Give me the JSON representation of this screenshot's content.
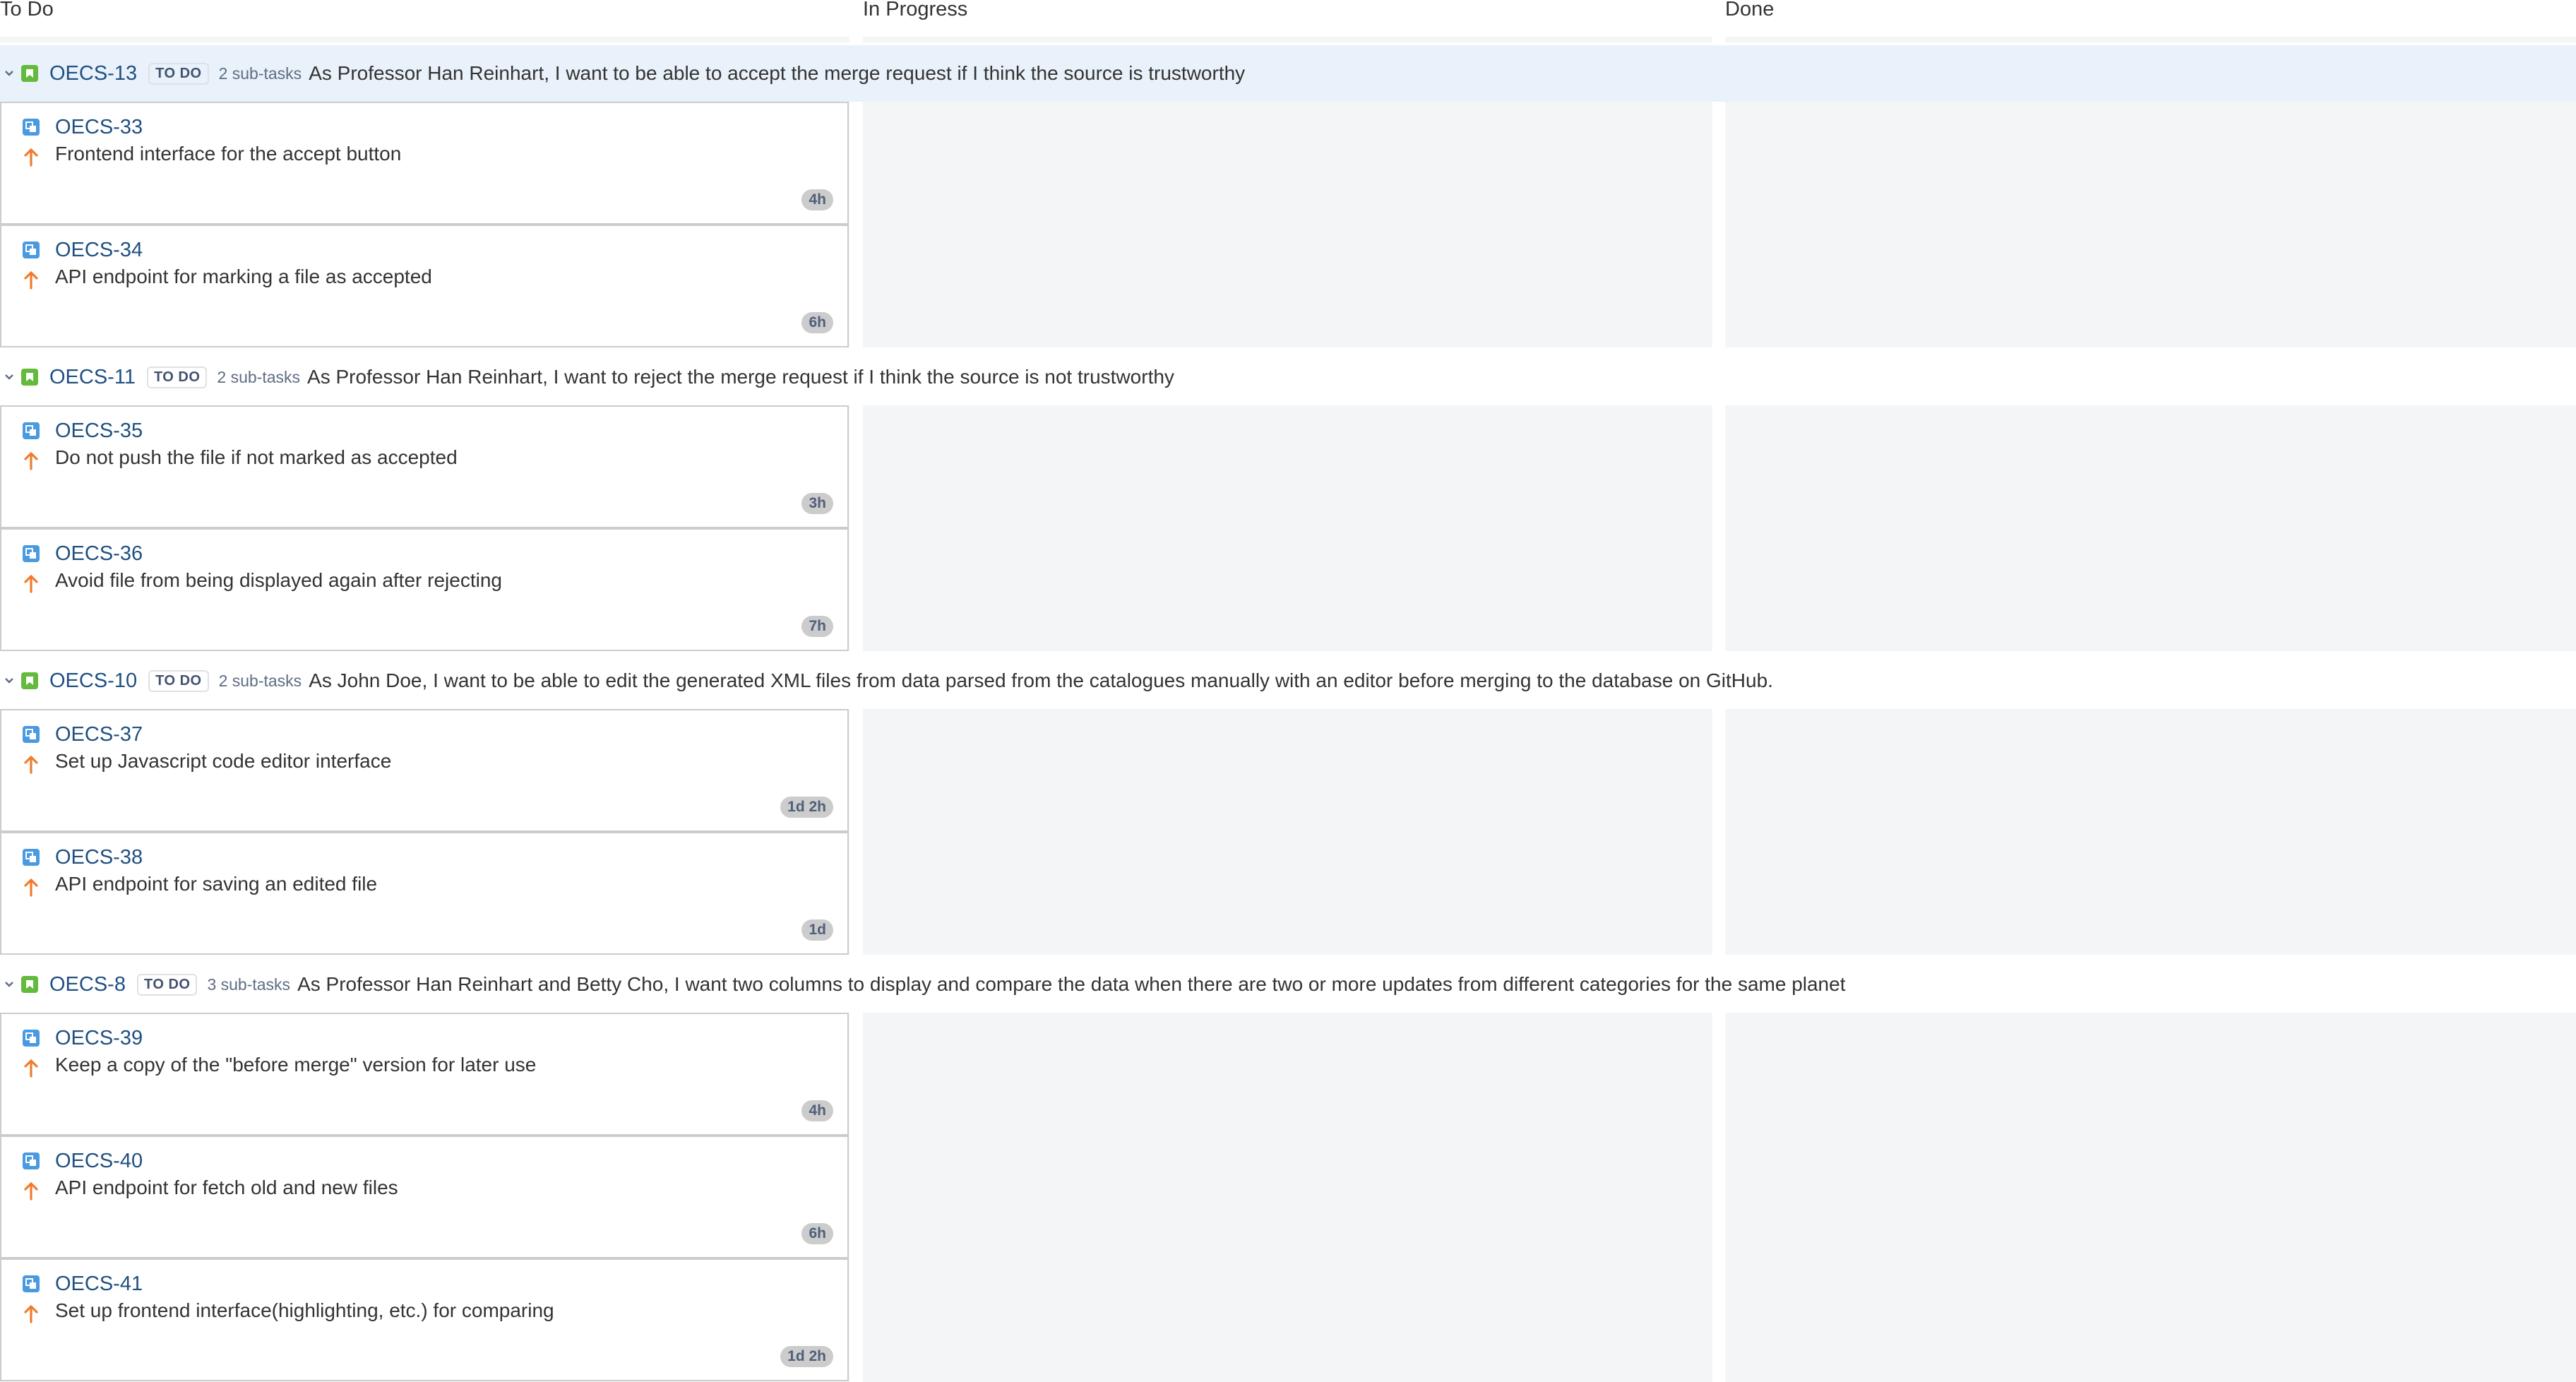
{
  "columns": [
    {
      "label": "To Do"
    },
    {
      "label": "In Progress"
    },
    {
      "label": "Done"
    }
  ],
  "colors": {
    "story": "#63ba3c",
    "subtask": "#4a9ae1",
    "priority_high": "#f17b2d",
    "link": "#205081",
    "lane_highlight": "#e9f2fa",
    "column_bg": "#f4f5f7"
  },
  "icons": {
    "chevron": "chevron-down-icon",
    "story": "story-icon",
    "subtask": "subtask-icon",
    "priority": "priority-high-arrow-icon"
  },
  "swimlanes": [
    {
      "key": "OECS-13",
      "status": "TO DO",
      "subtasks": "2 sub-tasks",
      "summary": "As Professor Han Reinhart, I want to be able to accept the merge request if I think the source is trustworthy",
      "highlighted": true,
      "cards": [
        {
          "key": "OECS-33",
          "summary": "Frontend interface for the accept button",
          "estimate": "4h"
        },
        {
          "key": "OECS-34",
          "summary": "API endpoint for marking a file as accepted",
          "estimate": "6h"
        }
      ]
    },
    {
      "key": "OECS-11",
      "status": "TO DO",
      "subtasks": "2 sub-tasks",
      "summary": "As Professor Han Reinhart, I want to reject the merge request if I think the source is not trustworthy",
      "highlighted": false,
      "cards": [
        {
          "key": "OECS-35",
          "summary": "Do not push the file if not marked as accepted",
          "estimate": "3h"
        },
        {
          "key": "OECS-36",
          "summary": "Avoid file from being displayed again after rejecting",
          "estimate": "7h"
        }
      ]
    },
    {
      "key": "OECS-10",
      "status": "TO DO",
      "subtasks": "2 sub-tasks",
      "summary": "As John Doe, I want to be able to edit the generated XML files from data parsed from the catalogues manually with an editor before merging to the database on GitHub.",
      "highlighted": false,
      "cards": [
        {
          "key": "OECS-37",
          "summary": "Set up Javascript code editor interface",
          "estimate": "1d 2h"
        },
        {
          "key": "OECS-38",
          "summary": "API endpoint for saving an edited file",
          "estimate": "1d"
        }
      ]
    },
    {
      "key": "OECS-8",
      "status": "TO DO",
      "subtasks": "3 sub-tasks",
      "summary": "As Professor Han Reinhart and Betty Cho, I want two columns to display and compare the data when there are two or more updates from different categories for the same planet",
      "highlighted": false,
      "cards": [
        {
          "key": "OECS-39",
          "summary": "Keep a copy of the \"before merge\" version for later use",
          "estimate": "4h"
        },
        {
          "key": "OECS-40",
          "summary": "API endpoint for fetch old and new files",
          "estimate": "6h"
        },
        {
          "key": "OECS-41",
          "summary": "Set up frontend interface(highlighting, etc.) for comparing",
          "estimate": "1d 2h"
        }
      ]
    }
  ]
}
